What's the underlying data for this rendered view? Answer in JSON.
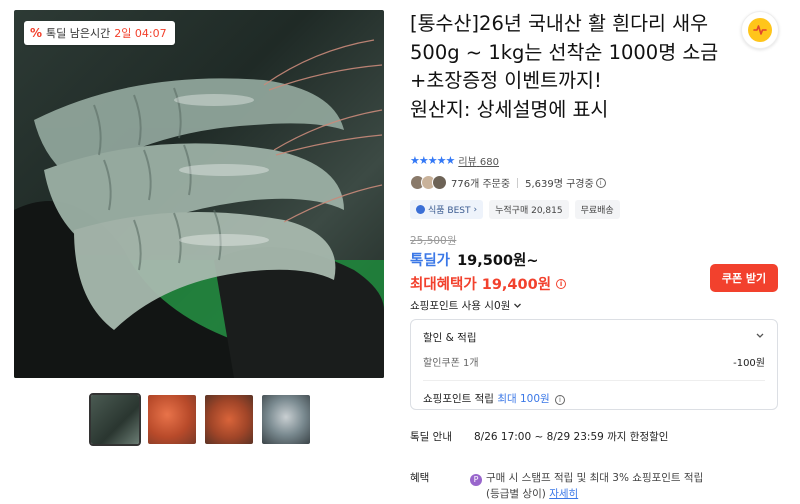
{
  "gallery": {
    "deal_badge": {
      "icon": "%",
      "label": "톡딜 남은시간",
      "time": "2일 04:07"
    },
    "thumbnails": [
      {
        "name": "shrimp-main"
      },
      {
        "name": "shrimp-cooked-1"
      },
      {
        "name": "shrimp-cooked-2"
      },
      {
        "name": "shrimp-on-ice"
      }
    ]
  },
  "product": {
    "title": "[통수산]26년 국내산 활 흰다리 새우 500g ~ 1kg는 선착순 1000명 소금+초장증정 이벤트까지!\n원산지: 상세설명에 표시",
    "hot_icon": "hot-deal-icon"
  },
  "rating": {
    "stars": "★★★★★",
    "review_label": "리뷰",
    "review_count": "680"
  },
  "orders": {
    "ordering": "776개 주문중",
    "subscribers": "5,639명 구경중"
  },
  "tags": {
    "best": "식품 BEST",
    "cumulative": "누적구매 20,815",
    "shipping": "무료배송"
  },
  "price": {
    "original": "25,500원",
    "deal_label": "톡딜가",
    "deal_value": "19,500원~",
    "max_benefit": "최대혜택가 19,400원",
    "coupon_button": "쿠폰 받기",
    "point_use": "쇼핑포인트 사용 시0원"
  },
  "discount": {
    "title": "할인 & 적립",
    "coupon_label": "할인쿠폰 1개",
    "coupon_value": "-100원",
    "point_label": "쇼핑포인트 적립",
    "point_value": "최대 100원"
  },
  "deal_info": {
    "label": "톡딜 안내",
    "text": "8/26 17:00 ~ 8/29 23:59 까지 한정할인"
  },
  "benefit": {
    "label": "혜택",
    "text": "구매 시 스탬프 적립 및 최대 3% 쇼핑포인트 적립",
    "sub": "(등급별 상이)",
    "more": "자세히"
  }
}
